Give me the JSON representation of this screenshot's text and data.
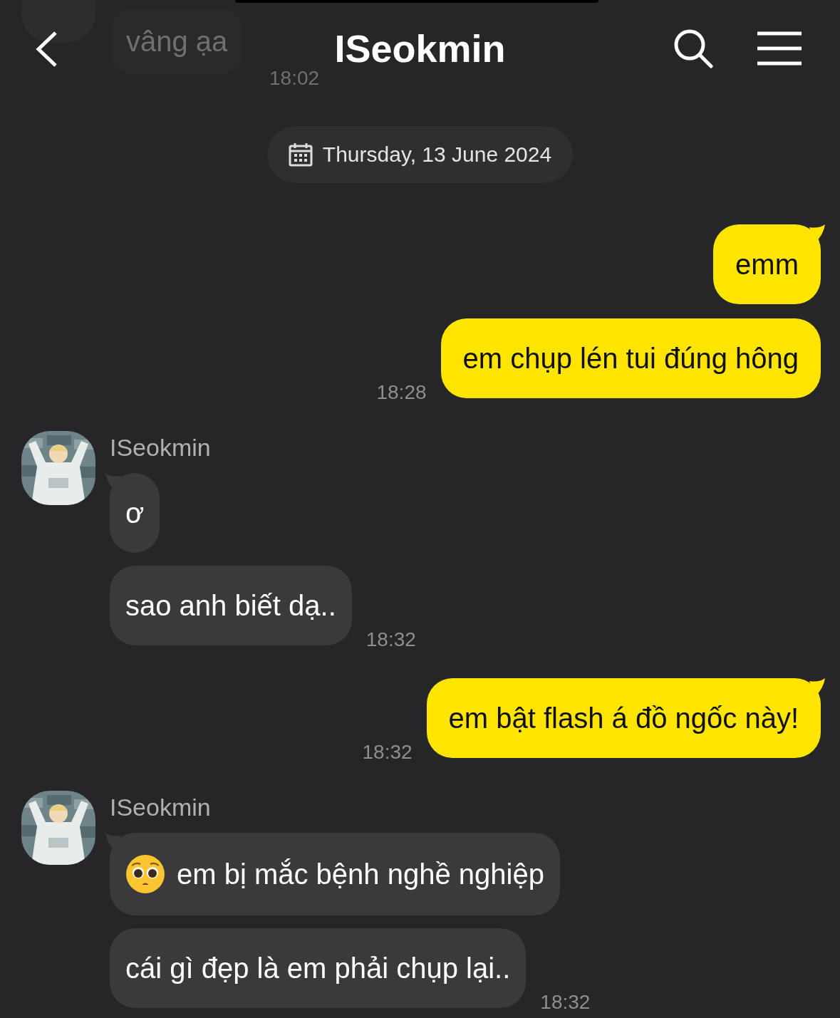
{
  "header": {
    "title": "ISeokmin"
  },
  "faded_message": {
    "text": "vâng ạa",
    "time": "18:02"
  },
  "date_divider": {
    "text": "Thursday, 13 June 2024"
  },
  "groups": [
    {
      "kind": "out",
      "bubbles": [
        {
          "text": "emm"
        },
        {
          "text": "em chụp lén tui đúng hông"
        }
      ],
      "time": "18:28"
    },
    {
      "kind": "in",
      "sender": "ISeokmin",
      "bubbles": [
        {
          "text": "ơ",
          "leading_emoji": false
        },
        {
          "text": "sao anh biết dạ..",
          "leading_emoji": false
        }
      ],
      "time": "18:32"
    },
    {
      "kind": "out",
      "bubbles": [
        {
          "text": "em bật flash á đồ ngốc này!"
        }
      ],
      "time": "18:32"
    },
    {
      "kind": "in",
      "sender": "ISeokmin",
      "bubbles": [
        {
          "text": "em bị mắc bệnh nghề nghiệp",
          "leading_emoji": true
        },
        {
          "text": "cái gì đẹp là em phải chụp lại..",
          "leading_emoji": false
        }
      ],
      "time": "18:32"
    }
  ]
}
